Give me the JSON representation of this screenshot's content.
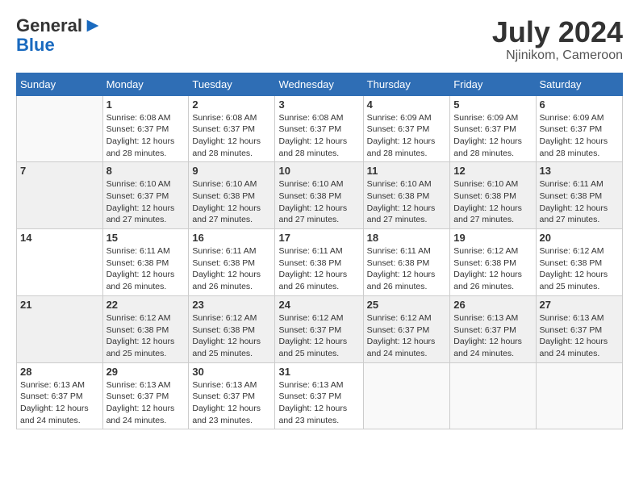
{
  "header": {
    "logo_line1": "General",
    "logo_line2": "Blue",
    "month": "July 2024",
    "location": "Njinikom, Cameroon"
  },
  "days_of_week": [
    "Sunday",
    "Monday",
    "Tuesday",
    "Wednesday",
    "Thursday",
    "Friday",
    "Saturday"
  ],
  "weeks": [
    [
      {
        "day": "",
        "info": ""
      },
      {
        "day": "1",
        "info": "Sunrise: 6:08 AM\nSunset: 6:37 PM\nDaylight: 12 hours\nand 28 minutes."
      },
      {
        "day": "2",
        "info": "Sunrise: 6:08 AM\nSunset: 6:37 PM\nDaylight: 12 hours\nand 28 minutes."
      },
      {
        "day": "3",
        "info": "Sunrise: 6:08 AM\nSunset: 6:37 PM\nDaylight: 12 hours\nand 28 minutes."
      },
      {
        "day": "4",
        "info": "Sunrise: 6:09 AM\nSunset: 6:37 PM\nDaylight: 12 hours\nand 28 minutes."
      },
      {
        "day": "5",
        "info": "Sunrise: 6:09 AM\nSunset: 6:37 PM\nDaylight: 12 hours\nand 28 minutes."
      },
      {
        "day": "6",
        "info": "Sunrise: 6:09 AM\nSunset: 6:37 PM\nDaylight: 12 hours\nand 28 minutes."
      }
    ],
    [
      {
        "day": "7",
        "info": ""
      },
      {
        "day": "8",
        "info": "Sunrise: 6:10 AM\nSunset: 6:37 PM\nDaylight: 12 hours\nand 27 minutes."
      },
      {
        "day": "9",
        "info": "Sunrise: 6:10 AM\nSunset: 6:38 PM\nDaylight: 12 hours\nand 27 minutes."
      },
      {
        "day": "10",
        "info": "Sunrise: 6:10 AM\nSunset: 6:38 PM\nDaylight: 12 hours\nand 27 minutes."
      },
      {
        "day": "11",
        "info": "Sunrise: 6:10 AM\nSunset: 6:38 PM\nDaylight: 12 hours\nand 27 minutes."
      },
      {
        "day": "12",
        "info": "Sunrise: 6:10 AM\nSunset: 6:38 PM\nDaylight: 12 hours\nand 27 minutes."
      },
      {
        "day": "13",
        "info": "Sunrise: 6:11 AM\nSunset: 6:38 PM\nDaylight: 12 hours\nand 27 minutes."
      }
    ],
    [
      {
        "day": "14",
        "info": ""
      },
      {
        "day": "15",
        "info": "Sunrise: 6:11 AM\nSunset: 6:38 PM\nDaylight: 12 hours\nand 26 minutes."
      },
      {
        "day": "16",
        "info": "Sunrise: 6:11 AM\nSunset: 6:38 PM\nDaylight: 12 hours\nand 26 minutes."
      },
      {
        "day": "17",
        "info": "Sunrise: 6:11 AM\nSunset: 6:38 PM\nDaylight: 12 hours\nand 26 minutes."
      },
      {
        "day": "18",
        "info": "Sunrise: 6:11 AM\nSunset: 6:38 PM\nDaylight: 12 hours\nand 26 minutes."
      },
      {
        "day": "19",
        "info": "Sunrise: 6:12 AM\nSunset: 6:38 PM\nDaylight: 12 hours\nand 26 minutes."
      },
      {
        "day": "20",
        "info": "Sunrise: 6:12 AM\nSunset: 6:38 PM\nDaylight: 12 hours\nand 25 minutes."
      }
    ],
    [
      {
        "day": "21",
        "info": ""
      },
      {
        "day": "22",
        "info": "Sunrise: 6:12 AM\nSunset: 6:38 PM\nDaylight: 12 hours\nand 25 minutes."
      },
      {
        "day": "23",
        "info": "Sunrise: 6:12 AM\nSunset: 6:38 PM\nDaylight: 12 hours\nand 25 minutes."
      },
      {
        "day": "24",
        "info": "Sunrise: 6:12 AM\nSunset: 6:37 PM\nDaylight: 12 hours\nand 25 minutes."
      },
      {
        "day": "25",
        "info": "Sunrise: 6:12 AM\nSunset: 6:37 PM\nDaylight: 12 hours\nand 24 minutes."
      },
      {
        "day": "26",
        "info": "Sunrise: 6:13 AM\nSunset: 6:37 PM\nDaylight: 12 hours\nand 24 minutes."
      },
      {
        "day": "27",
        "info": "Sunrise: 6:13 AM\nSunset: 6:37 PM\nDaylight: 12 hours\nand 24 minutes."
      }
    ],
    [
      {
        "day": "28",
        "info": "Sunrise: 6:13 AM\nSunset: 6:37 PM\nDaylight: 12 hours\nand 24 minutes."
      },
      {
        "day": "29",
        "info": "Sunrise: 6:13 AM\nSunset: 6:37 PM\nDaylight: 12 hours\nand 24 minutes."
      },
      {
        "day": "30",
        "info": "Sunrise: 6:13 AM\nSunset: 6:37 PM\nDaylight: 12 hours\nand 23 minutes."
      },
      {
        "day": "31",
        "info": "Sunrise: 6:13 AM\nSunset: 6:37 PM\nDaylight: 12 hours\nand 23 minutes."
      },
      {
        "day": "",
        "info": ""
      },
      {
        "day": "",
        "info": ""
      },
      {
        "day": "",
        "info": ""
      }
    ]
  ]
}
